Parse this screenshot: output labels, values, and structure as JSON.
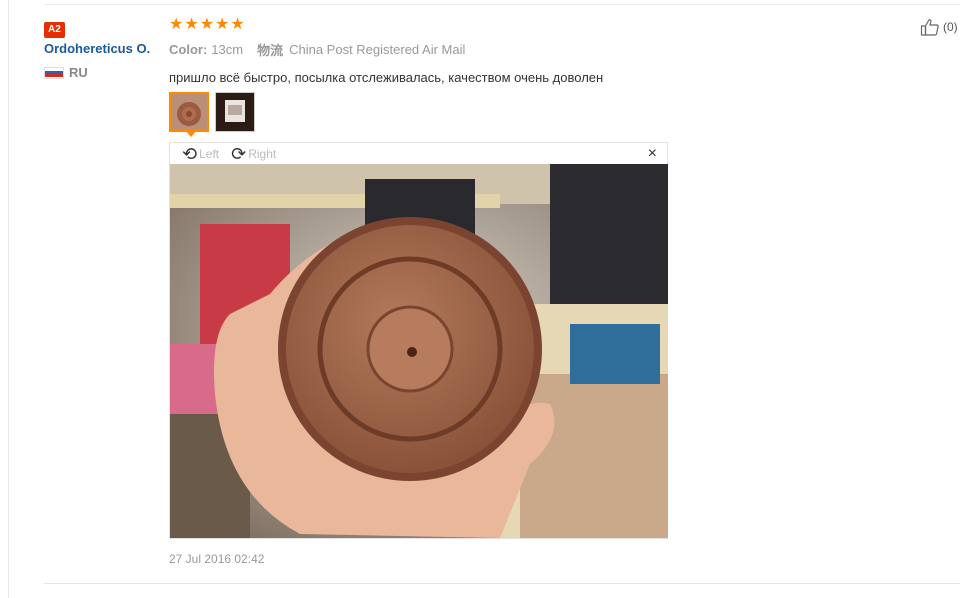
{
  "user": {
    "level": "A2",
    "name": "Ordohereticus O.",
    "country": "RU"
  },
  "review": {
    "rating": 5,
    "color_label": "Color:",
    "color_value": "13cm",
    "shipping_label": "物流",
    "shipping_value": "China Post Registered Air Mail",
    "text": "пришло всё быстро, посылка отслеживалась, качеством очень доволен",
    "timestamp": "27 Jul 2016 02:42"
  },
  "viewer": {
    "rotate_left": "Left",
    "rotate_right": "Right",
    "close": "×"
  },
  "helpful": {
    "count": "(0)"
  },
  "colors": {
    "star": "#ff8a00",
    "badge": "#e62e04",
    "username": "#1a5a9c"
  }
}
